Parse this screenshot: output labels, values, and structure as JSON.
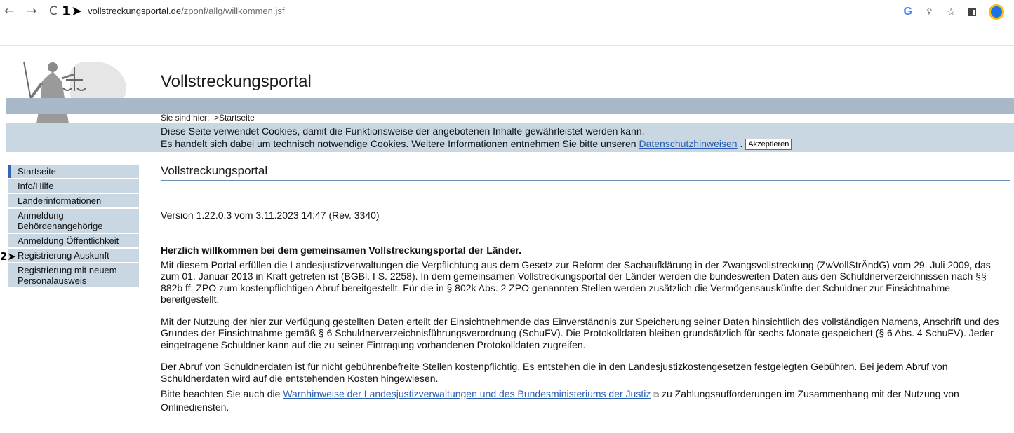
{
  "browser": {
    "back": "←",
    "forward": "→",
    "reload": "C",
    "marker1": "1➤",
    "url_host": "vollstreckungsportal.de",
    "url_path": "/zponf/allg/willkommen.jsf",
    "icons": [
      "google-g-icon",
      "share-icon",
      "star-icon",
      "side-panel-icon",
      "profile-avatar"
    ],
    "g_label": "G",
    "share_glyph": "⇪",
    "star_glyph": "☆"
  },
  "header": {
    "title": "Vollstreckungsportal",
    "breadcrumb_prefix": "Sie sind hier:",
    "breadcrumb_current": ">Startseite"
  },
  "cookie": {
    "line1": "Diese Seite verwendet Cookies, damit die Funktionsweise der angebotenen Inhalte gewährleistet werden kann.",
    "line2_pre": "Es handelt sich dabei um technisch notwendige Cookies. Weitere Informationen entnehmen Sie bitte unseren",
    "link": "Datenschutzhinweisen",
    "line2_post": ".",
    "accept": "Akzeptieren"
  },
  "sidebar": {
    "marker2": "2➤",
    "items": [
      {
        "label": "Startseite"
      },
      {
        "label": "Info/Hilfe"
      },
      {
        "label": "Länderinformationen"
      },
      {
        "label": "Anmeldung Behördenangehörige"
      },
      {
        "label": "Anmeldung Öffentlichkeit"
      },
      {
        "label": "Registrierung Auskunft"
      },
      {
        "label": "Registrierung mit neuem Personalausweis"
      }
    ]
  },
  "main": {
    "title": "Vollstreckungsportal",
    "version": "Version 1.22.0.3 vom 3.11.2023 14:47 (Rev. 3340)",
    "welcome": "Herzlich willkommen bei dem gemeinsamen Vollstreckungsportal der Länder.",
    "para1": "Mit diesem Portal erfüllen die Landesjustizverwaltungen die Verpflichtung aus dem Gesetz zur Reform der Sachaufklärung in der Zwangsvollstreckung (ZwVollStrÄndG) vom 29. Juli 2009, das zum 01. Januar 2013 in Kraft getreten ist (BGBl. I S. 2258). In dem gemeinsamen Vollstreckungsportal der Länder werden die bundesweiten Daten aus den Schuldnerverzeichnissen nach §§ 882b ff. ZPO zum kostenpflichtigen Abruf bereitgestellt. Für die in § 802k Abs. 2 ZPO genannten Stellen werden zusätzlich die Vermögensauskünfte der Schuldner zur Einsichtnahme bereitgestellt.",
    "para2": "Mit der Nutzung der hier zur Verfügung gestellten Daten erteilt der Einsichtnehmende das Einverständnis zur Speicherung seiner Daten hinsichtlich des vollständigen Namens, Anschrift und des Grundes der Einsichtnahme gemäß § 6 Schuldnerverzeichnisführungsverordnung (SchuFV). Die Protokolldaten bleiben grundsätzlich für sechs Monate gespeichert (§ 6 Abs. 4 SchuFV). Jeder eingetragene Schuldner kann auf die zu seiner Eintragung vorhandenen Protokolldaten zugreifen.",
    "para3": "Der Abruf von Schuldnerdaten ist für nicht gebührenbefreite Stellen kostenpflichtig. Es entstehen die in den Landesjustizkostengesetzen festgelegten Gebühren. Bei jedem Abruf von Schuldnerdaten wird auf die entstehenden Kosten hingewiesen.",
    "para4_pre": "Bitte beachten Sie auch die",
    "para4_link": "Warnhinweise der Landesjustizverwaltungen und des Bundesministeriums der Justiz",
    "para4_post": "zu Zahlungsaufforderungen im Zusammenhang mit der Nutzung von Onlinediensten."
  },
  "colors": {
    "accent_band": "#a8b8c8",
    "nav_bg": "#c9d7e3",
    "active_bar": "#3464b6",
    "link": "#2a5db0"
  }
}
